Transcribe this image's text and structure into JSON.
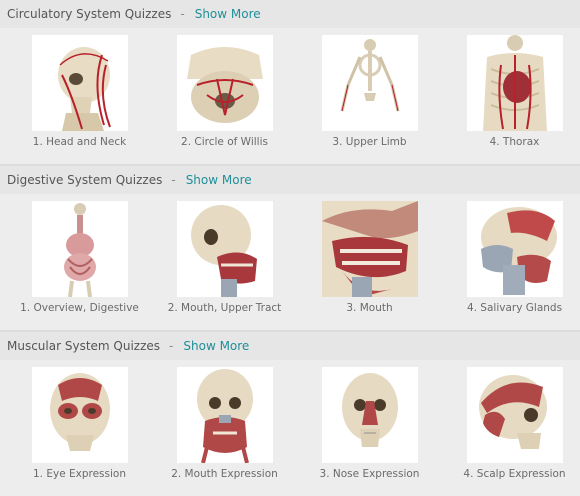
{
  "sections": [
    {
      "title": "Circulatory System Quizzes",
      "dash": "-",
      "more": "Show More",
      "items": [
        {
          "label": "1. Head and Neck",
          "icon": "skull-circulatory-icon"
        },
        {
          "label": "2. Circle of Willis",
          "icon": "skull-base-icon"
        },
        {
          "label": "3. Upper Limb",
          "icon": "skeleton-icon"
        },
        {
          "label": "4. Thorax",
          "icon": "thorax-icon"
        }
      ]
    },
    {
      "title": "Digestive System Quizzes",
      "dash": "-",
      "more": "Show More",
      "items": [
        {
          "label": "1. Overview, Digestive",
          "icon": "digestive-overview-icon"
        },
        {
          "label": "2. Mouth, Upper Tract",
          "icon": "skull-mouth-icon"
        },
        {
          "label": "3. Mouth",
          "icon": "mouth-closeup-icon"
        },
        {
          "label": "4. Salivary Glands",
          "icon": "salivary-glands-icon"
        }
      ]
    },
    {
      "title": "Muscular System Quizzes",
      "dash": "-",
      "more": "Show More",
      "items": [
        {
          "label": "1. Eye Expression",
          "icon": "eye-muscles-icon"
        },
        {
          "label": "2. Mouth Expression",
          "icon": "mouth-muscles-icon"
        },
        {
          "label": "3. Nose Expression",
          "icon": "nose-muscles-icon"
        },
        {
          "label": "4. Scalp Expression",
          "icon": "scalp-muscles-icon"
        }
      ]
    }
  ],
  "colors": {
    "link": "#1f8f98",
    "bone": "#e6dcc8",
    "muscle": "#b04848",
    "vessel": "#b8202a"
  }
}
